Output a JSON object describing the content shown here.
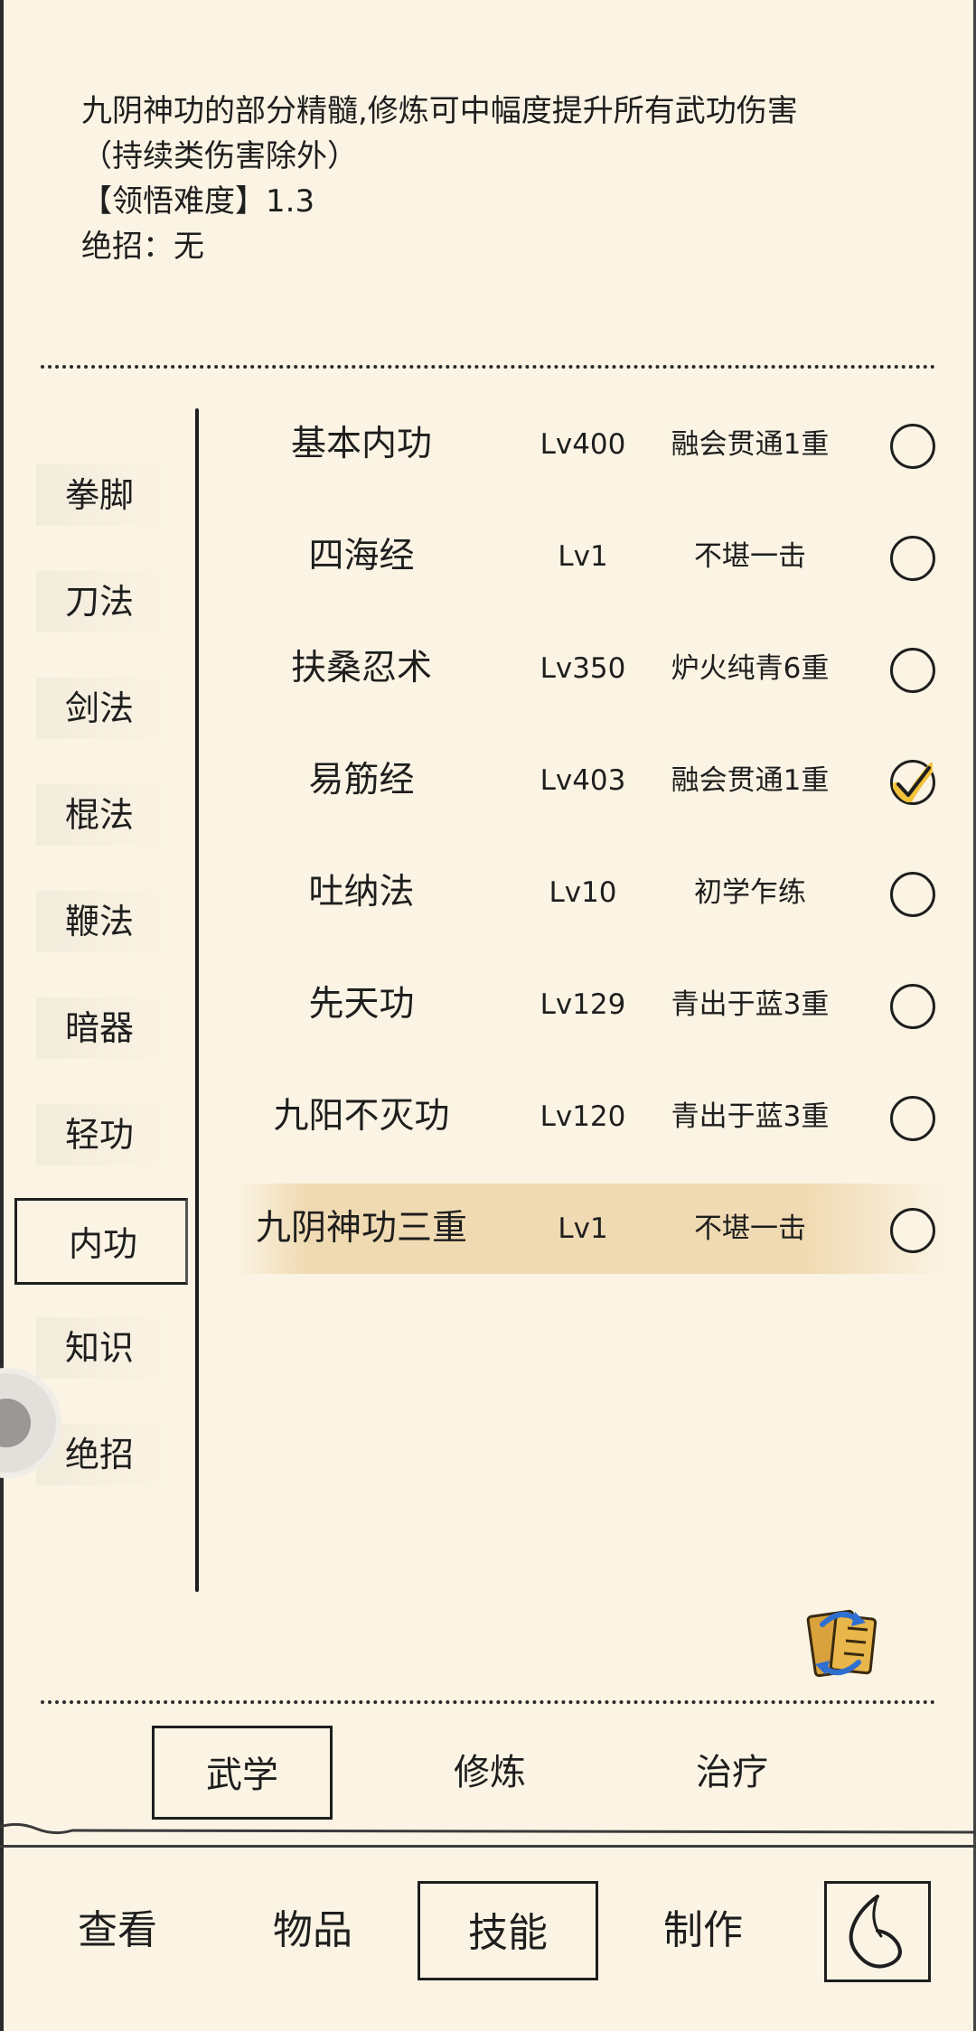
{
  "description": {
    "line1": "九阴神功的部分精髓,修炼可中幅度提升所有武功伤害",
    "line2": "（持续类伤害除外）",
    "line3": "【领悟难度】1.3",
    "line4": "绝招：无"
  },
  "categories": [
    {
      "label": "拳脚"
    },
    {
      "label": "刀法"
    },
    {
      "label": "剑法"
    },
    {
      "label": "棍法"
    },
    {
      "label": "鞭法"
    },
    {
      "label": "暗器"
    },
    {
      "label": "轻功"
    },
    {
      "label": "内功",
      "selected": true
    },
    {
      "label": "知识"
    },
    {
      "label": "绝招"
    }
  ],
  "skills": [
    {
      "name": "基本内功",
      "level": "Lv400",
      "stage": "融会贯通1重",
      "checked": false
    },
    {
      "name": "四海经",
      "level": "Lv1",
      "stage": "不堪一击",
      "checked": false
    },
    {
      "name": "扶桑忍术",
      "level": "Lv350",
      "stage": "炉火纯青6重",
      "checked": false
    },
    {
      "name": "易筋经",
      "level": "Lv403",
      "stage": "融会贯通1重",
      "checked": true
    },
    {
      "name": "吐纳法",
      "level": "Lv10",
      "stage": "初学乍练",
      "checked": false
    },
    {
      "name": "先天功",
      "level": "Lv129",
      "stage": "青出于蓝3重",
      "checked": false
    },
    {
      "name": "九阳不灭功",
      "level": "Lv120",
      "stage": "青出于蓝3重",
      "checked": false
    },
    {
      "name": "九阴神功三重",
      "level": "Lv1",
      "stage": "不堪一击",
      "checked": false,
      "highlighted": true
    }
  ],
  "sub_tabs": [
    {
      "label": "武学",
      "selected": true
    },
    {
      "label": "修炼"
    },
    {
      "label": "治疗"
    }
  ],
  "nav_tabs": [
    {
      "label": "查看"
    },
    {
      "label": "物品"
    },
    {
      "label": "技能",
      "selected": true
    },
    {
      "label": "制作"
    }
  ],
  "icons": {
    "book": "book-swap-icon",
    "back": "back-arrow-icon",
    "float": "floating-assist-icon",
    "check": "checkmark-icon"
  },
  "colors": {
    "background": "#fbf4e4",
    "ink": "#1e1e1e",
    "highlight": "#eed6aa",
    "check_fill": "#f2c23a"
  }
}
